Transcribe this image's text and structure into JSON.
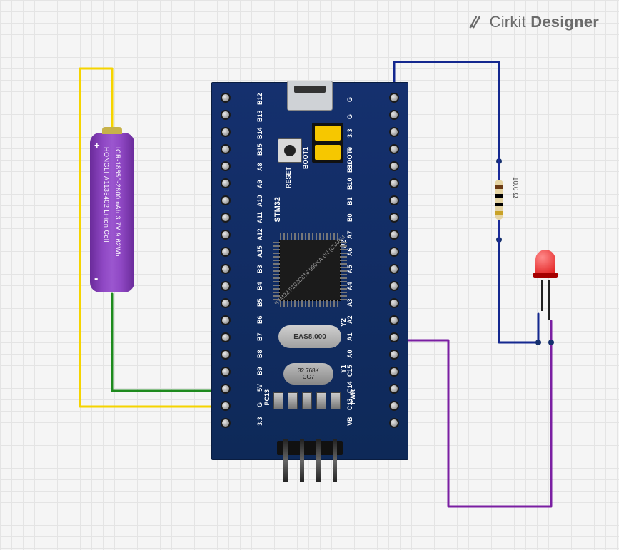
{
  "logo": {
    "brand": "Cirkit",
    "designer": "Designer"
  },
  "board": {
    "model": "STM32",
    "silk": {
      "boot0": "BOOT0",
      "boot1": "BOOT1",
      "reset": "RESET",
      "u2": "U2",
      "y1": "Y1",
      "y2": "Y2",
      "pwr": "PWR",
      "pc13": "PC13"
    },
    "crystal_big": "EAS8.000",
    "crystal_small_top": "32.768K",
    "crystal_small_bot": "CG7",
    "chip_text": "STM32\nF103C8T6\n990XA-0N\n(C)ARM",
    "pins_left": [
      "B12",
      "B13",
      "B14",
      "B15",
      "A8",
      "A9",
      "A10",
      "A11",
      "A12",
      "A15",
      "B3",
      "B4",
      "B5",
      "B6",
      "B7",
      "B8",
      "B9",
      "5V",
      "G",
      "3.3"
    ],
    "pins_right": [
      "G",
      "G",
      "3.3",
      "R",
      "B11",
      "B10",
      "B1",
      "B0",
      "A7",
      "A6",
      "A5",
      "A4",
      "A3",
      "A2",
      "A1",
      "A0",
      "C15",
      "C14",
      "C13",
      "VB"
    ]
  },
  "battery": {
    "line1": "ICR-18650-2600mAh 3.7V 9.62Wh",
    "line2": "HONGLI-A1135402 Li-ion Cell",
    "plus": "+",
    "minus": "-"
  },
  "resistor": {
    "value": "10.0",
    "unit": "Ω"
  },
  "components": {
    "battery_name": "18650-battery",
    "board_name": "stm32-blue-pill",
    "resistor_name": "resistor-10ohm",
    "led_name": "led-red"
  },
  "wires": {
    "yellow_desc": "battery + to board 3.3",
    "green_desc": "battery - to board G",
    "navy_desc": "board G to resistor to LED cathode",
    "purple_desc": "board A0 to LED anode"
  }
}
